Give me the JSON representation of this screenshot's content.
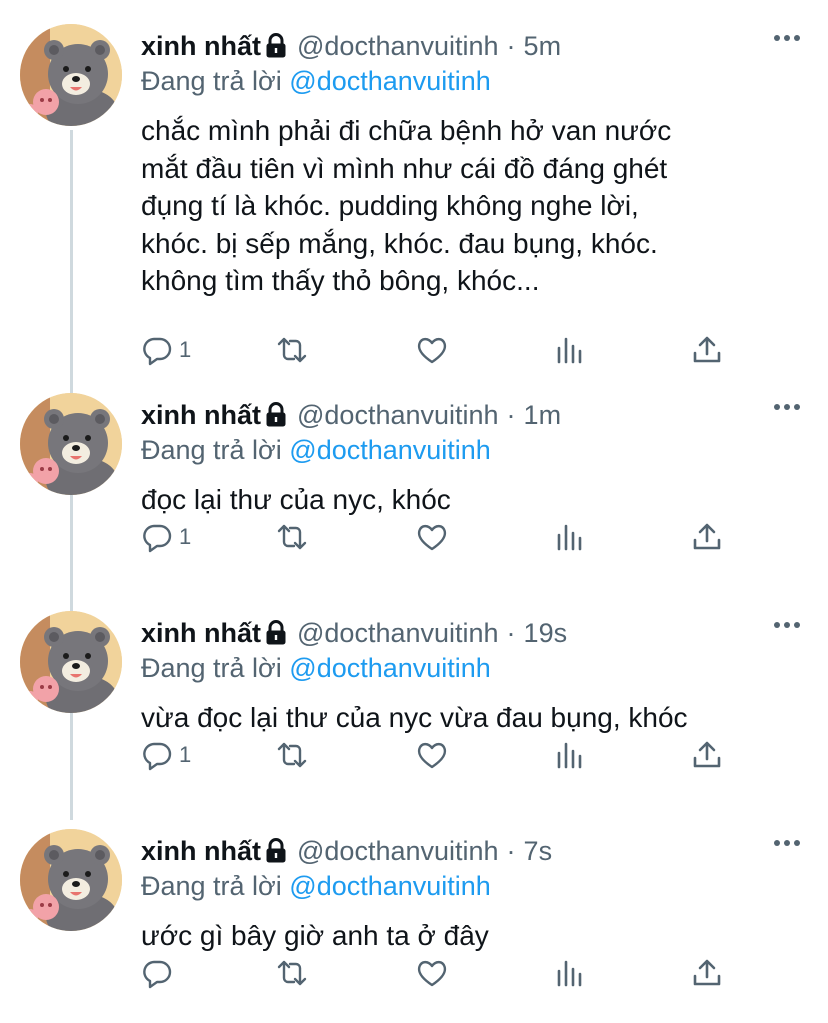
{
  "tweets": [
    {
      "name": "xinh nhất",
      "handle": "@docthanvuitinh",
      "dot": "·",
      "time": "5m",
      "reply_prefix": "Đang trả lời",
      "reply_handle": "@docthanvuitinh",
      "lines": [
        "chắc mình phải đi chữa bệnh hở van nước",
        "mắt đầu tiên vì mình như cái đồ đáng ghét",
        "đụng tí là khóc. pudding không nghe lời,",
        "khóc. bị sếp mắng, khóc. đau bụng, khóc.",
        "không tìm thấy thỏ bông, khóc..."
      ],
      "reply_count": "1"
    },
    {
      "name": "xinh nhất",
      "handle": "@docthanvuitinh",
      "dot": "·",
      "time": "1m",
      "reply_prefix": "Đang trả lời",
      "reply_handle": "@docthanvuitinh",
      "lines": [
        "đọc lại thư của nyc, khóc"
      ],
      "reply_count": "1"
    },
    {
      "name": "xinh nhất",
      "handle": "@docthanvuitinh",
      "dot": "·",
      "time": "19s",
      "reply_prefix": "Đang trả lời",
      "reply_handle": "@docthanvuitinh",
      "lines": [
        "vừa đọc lại thư của nyc vừa đau bụng, khóc"
      ],
      "reply_count": "1"
    },
    {
      "name": "xinh nhất",
      "handle": "@docthanvuitinh",
      "dot": "·",
      "time": "7s",
      "reply_prefix": "Đang trả lời",
      "reply_handle": "@docthanvuitinh",
      "lines": [
        "ước gì bây giờ anh ta ở đây"
      ],
      "reply_count": ""
    }
  ],
  "icons": {
    "reply": "reply-icon",
    "retweet": "retweet-icon",
    "like": "heart-icon",
    "analytics": "analytics-icon",
    "share": "share-icon",
    "lock": "lock-icon",
    "more": "more-icon"
  },
  "colors": {
    "link": "#1d9bf0",
    "secondary_text": "#536471",
    "thread_line": "#cfd9de"
  }
}
